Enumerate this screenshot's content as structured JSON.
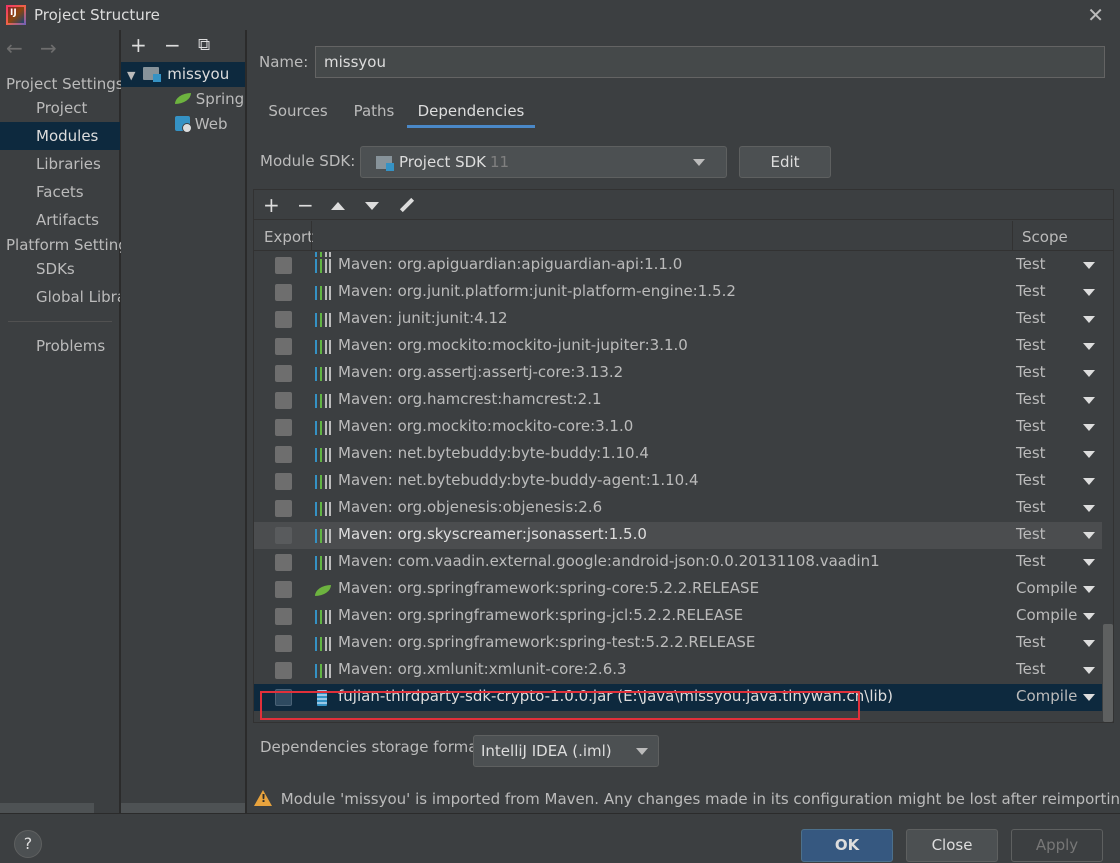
{
  "window": {
    "title": "Project Structure"
  },
  "nav": {
    "project_settings": "Project Settings",
    "platform_settings": "Platform Settings",
    "items": {
      "project": "Project",
      "modules": "Modules",
      "libraries": "Libraries",
      "facets": "Facets",
      "artifacts": "Artifacts",
      "sdks": "SDKs",
      "global_libraries": "Global Libraries",
      "problems": "Problems"
    }
  },
  "tree": {
    "module": "missyou",
    "children": [
      "Spring",
      "Web"
    ]
  },
  "module": {
    "name_label": "Name:",
    "name_value": "missyou",
    "tabs": [
      "Sources",
      "Paths",
      "Dependencies"
    ],
    "active_tab": "Dependencies",
    "sdk_label": "Module SDK:",
    "sdk_value": "Project SDK",
    "sdk_version": "11",
    "edit_label": "Edit"
  },
  "deps": {
    "header_export": "Export",
    "header_scope": "Scope",
    "rows": [
      {
        "text": "Maven: org.apiguardian:apiguardian-api:1.1.0",
        "scope": "Test",
        "icon": "maven-library-icon"
      },
      {
        "text": "Maven: org.junit.platform:junit-platform-engine:1.5.2",
        "scope": "Test",
        "icon": "maven-library-icon"
      },
      {
        "text": "Maven: junit:junit:4.12",
        "scope": "Test",
        "icon": "maven-library-icon"
      },
      {
        "text": "Maven: org.mockito:mockito-junit-jupiter:3.1.0",
        "scope": "Test",
        "icon": "maven-library-icon"
      },
      {
        "text": "Maven: org.assertj:assertj-core:3.13.2",
        "scope": "Test",
        "icon": "maven-library-icon"
      },
      {
        "text": "Maven: org.hamcrest:hamcrest:2.1",
        "scope": "Test",
        "icon": "maven-library-icon"
      },
      {
        "text": "Maven: org.mockito:mockito-core:3.1.0",
        "scope": "Test",
        "icon": "maven-library-icon"
      },
      {
        "text": "Maven: net.bytebuddy:byte-buddy:1.10.4",
        "scope": "Test",
        "icon": "maven-library-icon"
      },
      {
        "text": "Maven: net.bytebuddy:byte-buddy-agent:1.10.4",
        "scope": "Test",
        "icon": "maven-library-icon"
      },
      {
        "text": "Maven: org.objenesis:objenesis:2.6",
        "scope": "Test",
        "icon": "maven-library-icon"
      },
      {
        "text": "Maven: org.skyscreamer:jsonassert:1.5.0",
        "scope": "Test",
        "icon": "maven-library-icon",
        "state": "hover"
      },
      {
        "text": "Maven: com.vaadin.external.google:android-json:0.0.20131108.vaadin1",
        "scope": "Test",
        "icon": "maven-library-icon"
      },
      {
        "text": "Maven: org.springframework:spring-core:5.2.2.RELEASE",
        "scope": "Compile",
        "icon": "spring-leaf-icon"
      },
      {
        "text": "Maven: org.springframework:spring-jcl:5.2.2.RELEASE",
        "scope": "Compile",
        "icon": "maven-library-icon"
      },
      {
        "text": "Maven: org.springframework:spring-test:5.2.2.RELEASE",
        "scope": "Test",
        "icon": "maven-library-icon"
      },
      {
        "text": "Maven: org.xmlunit:xmlunit-core:2.6.3",
        "scope": "Test",
        "icon": "maven-library-icon"
      },
      {
        "text": "fujian-thirdparty-sdk-crypto-1.0.0.jar (E:\\Java\\missyou.java.tinywan.cn\\lib)",
        "scope": "Compile",
        "icon": "jar-icon",
        "state": "selected"
      }
    ]
  },
  "storage": {
    "label": "Dependencies storage format:",
    "value": "IntelliJ IDEA (.iml)"
  },
  "warning": "Module 'missyou' is imported from Maven. Any changes made in its configuration might be lost after reimporting.",
  "footer": {
    "ok": "OK",
    "close": "Close",
    "apply": "Apply",
    "help": "?"
  }
}
